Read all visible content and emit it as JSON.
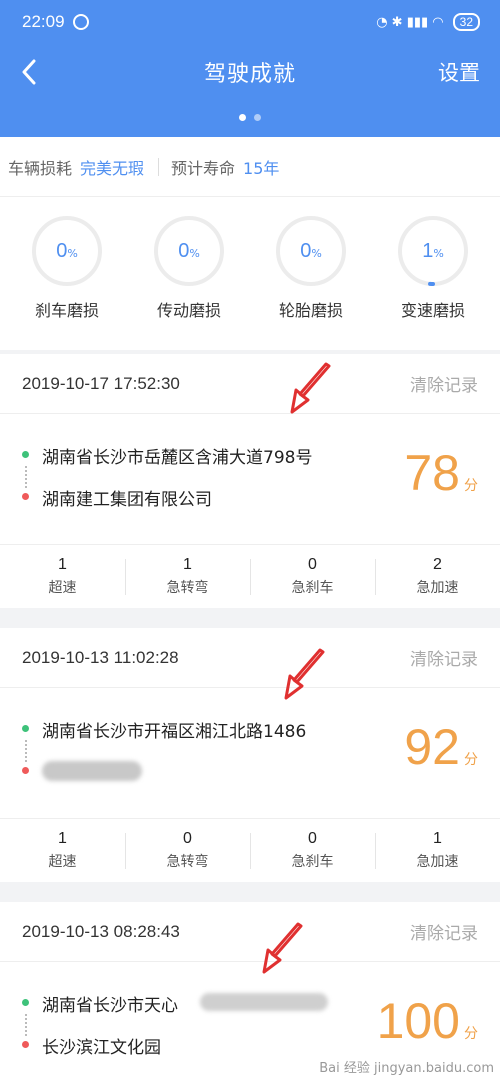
{
  "status": {
    "time": "22:09",
    "battery": "32"
  },
  "nav": {
    "title": "驾驶成就",
    "settings": "设置"
  },
  "summary": {
    "wear_label": "车辆损耗",
    "wear_value": "完美无瑕",
    "life_label": "预计寿命",
    "life_value": "15年"
  },
  "gauges": [
    {
      "value": "0",
      "unit": "%",
      "label": "刹车磨损",
      "fraction": 0
    },
    {
      "value": "0",
      "unit": "%",
      "label": "传动磨损",
      "fraction": 0
    },
    {
      "value": "0",
      "unit": "%",
      "label": "轮胎磨损",
      "fraction": 0
    },
    {
      "value": "1",
      "unit": "%",
      "label": "变速磨损",
      "fraction": 0.01
    }
  ],
  "trips": [
    {
      "datetime": "2019-10-17 17:52:30",
      "clear": "清除记录",
      "from": "湖南省长沙市岳麓区含浦大道798号",
      "to": "湖南建工集团有限公司",
      "score": "78",
      "score_unit": "分",
      "stats": [
        {
          "n": "1",
          "l": "超速"
        },
        {
          "n": "1",
          "l": "急转弯"
        },
        {
          "n": "0",
          "l": "急刹车"
        },
        {
          "n": "2",
          "l": "急加速"
        }
      ]
    },
    {
      "datetime": "2019-10-13 11:02:28",
      "clear": "清除记录",
      "from": "湖南省长沙市开福区湘江北路1486",
      "to": "",
      "score": "92",
      "score_unit": "分",
      "stats": [
        {
          "n": "1",
          "l": "超速"
        },
        {
          "n": "0",
          "l": "急转弯"
        },
        {
          "n": "0",
          "l": "急刹车"
        },
        {
          "n": "1",
          "l": "急加速"
        }
      ]
    },
    {
      "datetime": "2019-10-13 08:28:43",
      "clear": "清除记录",
      "from": "湖南省长沙市天心",
      "to": "长沙滨江文化园",
      "score": "100",
      "score_unit": "分"
    }
  ],
  "watermark": "Bai 经验 jingyan.baidu.com",
  "colors": {
    "primary": "#4f8ff0",
    "score": "#f0a24a",
    "arrow": "#e03030"
  }
}
